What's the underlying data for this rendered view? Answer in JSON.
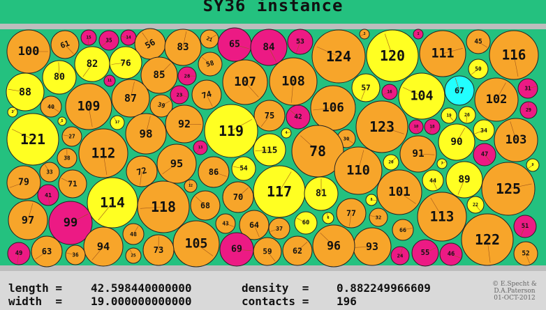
{
  "title": "SY36 instance",
  "stats": {
    "length_label": "length =",
    "length_value": "42.598440000000",
    "width_label": "width  =",
    "width_value": "19.000000000000",
    "density_label": "density  =",
    "density_value": "0.882249966609",
    "contacts_label": "contacts =",
    "contacts_value": "196"
  },
  "credit": {
    "line1": "© E.Specht &",
    "line2": "D.A.Paterson",
    "line3": "01-OCT-2012"
  },
  "colors": {
    "background": "#24c17f",
    "rail": "#bdbdbd",
    "orange": "#f7a52a",
    "yellow": "#ffff22",
    "magenta": "#ec1a84",
    "cyan": "#22ffff"
  },
  "circles": [
    "100",
    "61",
    "15",
    "35",
    "14",
    "56",
    "83",
    "21",
    "65",
    "84",
    "53",
    "3",
    "124",
    "120",
    "1",
    "111",
    "45",
    "116",
    "82",
    "76",
    "58",
    "80",
    "85",
    "28",
    "107",
    "108",
    "50",
    "88",
    "11",
    "87",
    "39",
    "23",
    "74",
    "57",
    "16",
    "104",
    "67",
    "102",
    "31",
    "40",
    "109",
    "75",
    "106",
    "42",
    "29",
    "2",
    "92",
    "19",
    "26",
    "5",
    "27",
    "17",
    "98",
    "119",
    "123",
    "10",
    "18",
    "34",
    "121",
    "103",
    "90",
    "4",
    "30",
    "112",
    "13",
    "115",
    "78",
    "38",
    "20",
    "91",
    "47",
    "72",
    "95",
    "54",
    "33",
    "110",
    "7",
    "86",
    "44",
    "89",
    "79",
    "71",
    "12",
    "117",
    "125",
    "101",
    "41",
    "114",
    "118",
    "68",
    "81",
    "70",
    "8",
    "22",
    "77",
    "9",
    "32",
    "113",
    "97",
    "99",
    "43",
    "64",
    "51",
    "37",
    "60",
    "6",
    "48",
    "66",
    "105",
    "122",
    "94",
    "93",
    "96",
    "73",
    "62",
    "69",
    "59",
    "49",
    "63",
    "36",
    "25",
    "24",
    "55",
    "46",
    "52"
  ]
}
